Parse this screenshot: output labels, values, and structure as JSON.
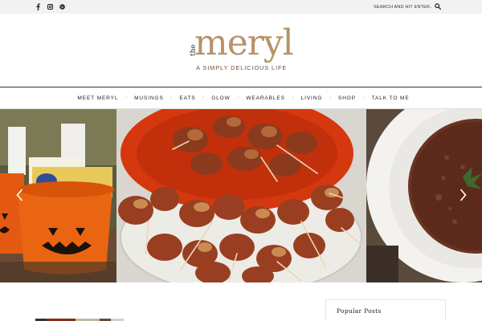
{
  "topbar": {
    "social": [
      {
        "name": "facebook-icon",
        "glyph": "f"
      },
      {
        "name": "instagram-icon",
        "glyph": ""
      },
      {
        "name": "pinterest-icon",
        "glyph": ""
      }
    ],
    "search_placeholder": "SEARCH AND HIT ENTER..."
  },
  "logo": {
    "prefix": "the",
    "name": "meryl",
    "tagline": "A SIMPLY DELICIOUS LIFE"
  },
  "nav": {
    "items": [
      "MEET MERYL",
      "MUSINGS",
      "EATS",
      "GLOW",
      "WEARABLES",
      "LIVING",
      "SHOP",
      "TALK TO ME"
    ]
  },
  "slider": {
    "slides": [
      {
        "name": "slide-halloween-pails"
      },
      {
        "name": "slide-bacon-wrapped-bites"
      },
      {
        "name": "slide-soup-bowl"
      }
    ]
  },
  "sidebar": {
    "title": "Popular Posts"
  },
  "colors": {
    "accent": "#b7926a",
    "tagline": "#6e4f3c",
    "topbar": "#f2f2f2"
  }
}
